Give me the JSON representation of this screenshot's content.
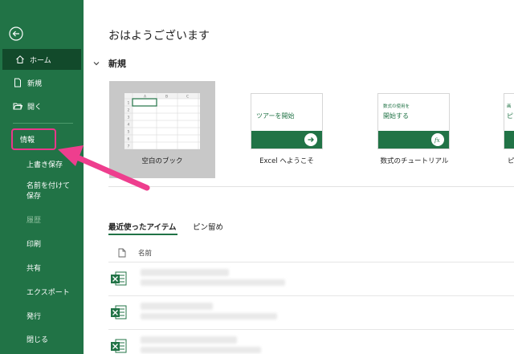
{
  "sidebar": {
    "back_icon": "back-arrow-icon",
    "items": [
      {
        "label": "ホーム",
        "icon": "home-icon"
      },
      {
        "label": "新規",
        "icon": "new-file-icon"
      },
      {
        "label": "開く",
        "icon": "open-folder-icon"
      },
      {
        "label": "情報"
      },
      {
        "label": "上書き保存"
      },
      {
        "label": "名前を付けて保存"
      },
      {
        "label": "履歴"
      },
      {
        "label": "印刷"
      },
      {
        "label": "共有"
      },
      {
        "label": "エクスポート"
      },
      {
        "label": "発行"
      },
      {
        "label": "閉じる"
      }
    ]
  },
  "main": {
    "greeting": "おはようございます",
    "new_section": {
      "title": "新規",
      "templates": [
        {
          "label": "空白のブック"
        },
        {
          "label": "Excel へようこそ",
          "card_text": "ツアーを開始"
        },
        {
          "label": "数式のチュートリアル",
          "card_small": "数式の使用を",
          "card_text": "開始する"
        },
        {
          "label": "ピ",
          "card_small": "画",
          "card_text": "ピ"
        }
      ],
      "grid_cols": [
        "A",
        "B",
        "C"
      ],
      "grid_rows": [
        "1",
        "2",
        "3",
        "4",
        "5",
        "6",
        "7"
      ]
    },
    "tabs": [
      {
        "label": "最近使ったアイテム"
      },
      {
        "label": "ピン留め"
      }
    ],
    "list_header": {
      "name_label": "名前",
      "file_icon": "document-icon"
    }
  },
  "colors": {
    "accent": "#217346",
    "highlight": "#e8388a",
    "active_nav": "#124a2b"
  }
}
